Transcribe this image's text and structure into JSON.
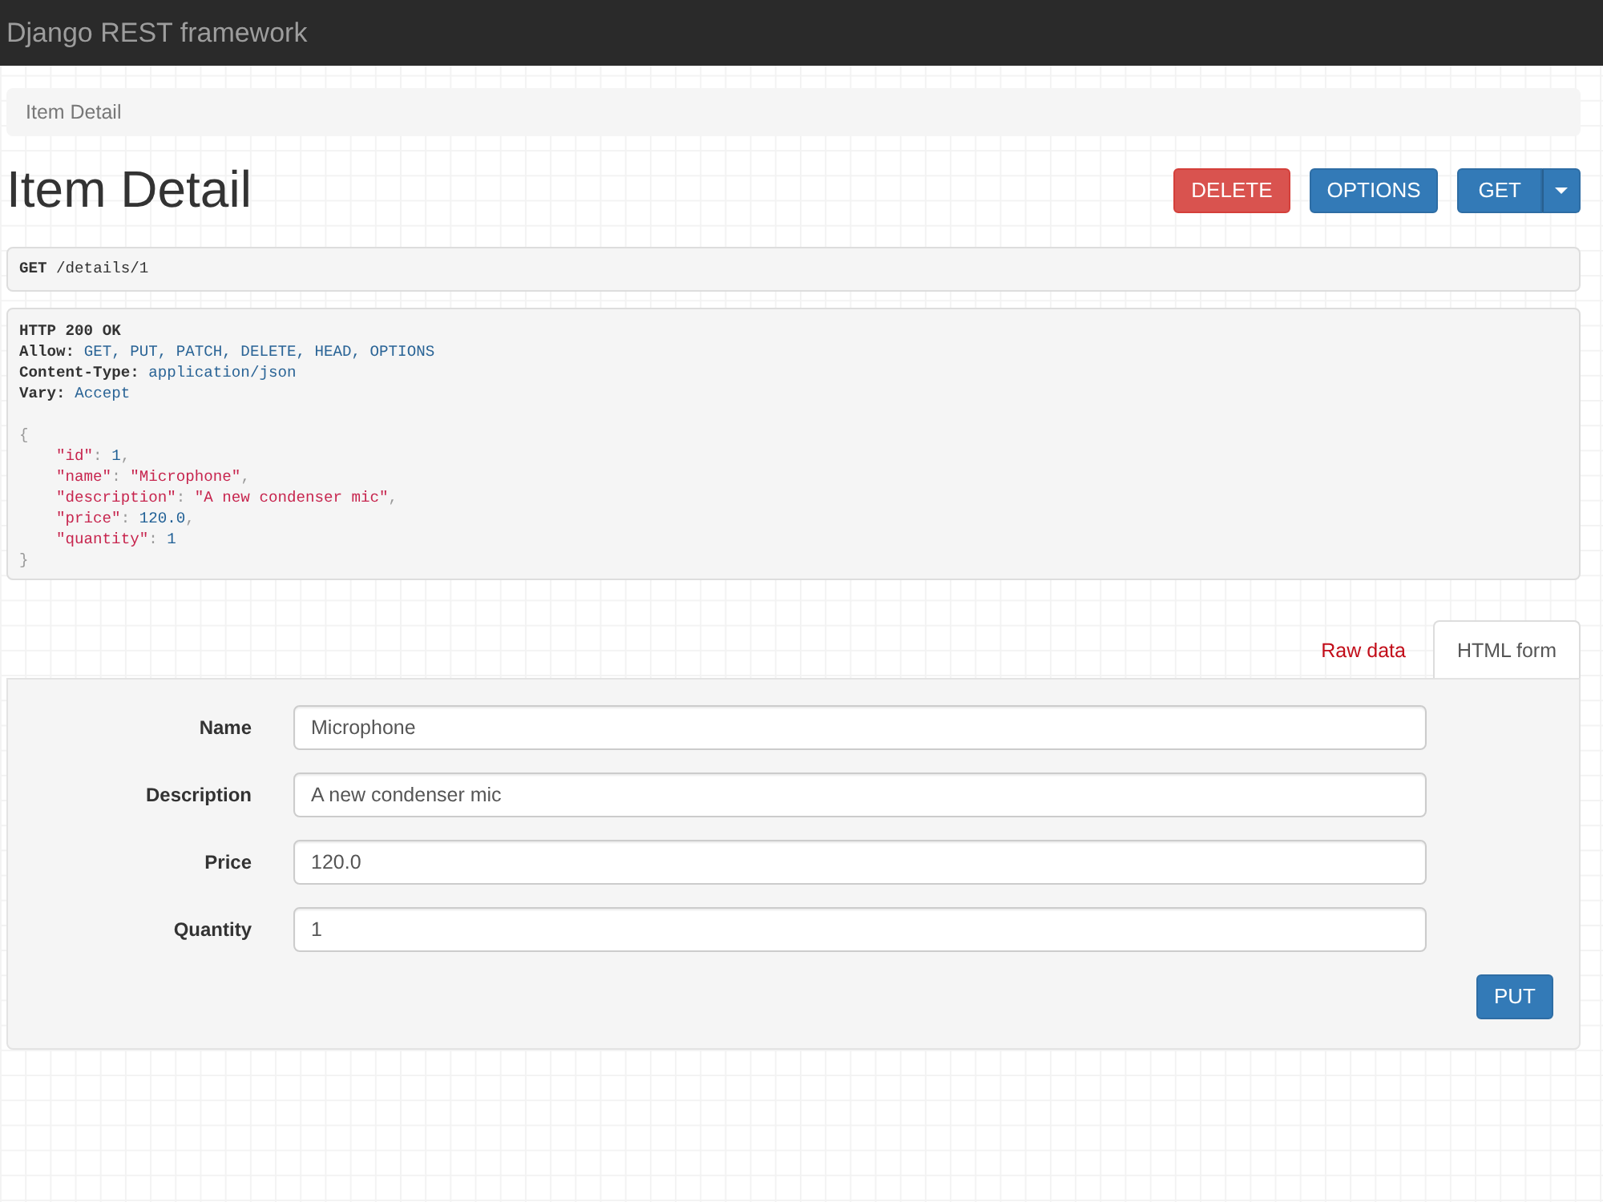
{
  "navbar": {
    "brand": "Django REST framework"
  },
  "breadcrumb": [
    "Item Detail"
  ],
  "header": {
    "title": "Item Detail",
    "actions": [
      {
        "label": "DELETE",
        "kind": "danger"
      },
      {
        "label": "OPTIONS",
        "kind": "primary"
      },
      {
        "label": "GET",
        "kind": "split"
      }
    ]
  },
  "request": {
    "method": "GET",
    "path": "/details/1"
  },
  "response": {
    "status": "HTTP 200 OK",
    "headers": [
      {
        "name": "Allow:",
        "value": "GET, PUT, PATCH, DELETE, HEAD, OPTIONS"
      },
      {
        "name": "Content-Type:",
        "value": "application/json"
      },
      {
        "name": "Vary:",
        "value": "Accept"
      }
    ],
    "body": {
      "open": "{",
      "members": [
        [
          {
            "text": "\"id\"",
            "kind": "key"
          },
          {
            "text": ":",
            "kind": "punct"
          },
          {
            "text": "1",
            "kind": "number"
          },
          {
            "text": ",",
            "kind": "punct"
          }
        ],
        [
          {
            "text": "\"name\"",
            "kind": "key"
          },
          {
            "text": ":",
            "kind": "punct"
          },
          {
            "text": "\"Microphone\"",
            "kind": "string"
          },
          {
            "text": ",",
            "kind": "punct"
          }
        ],
        [
          {
            "text": "\"description\"",
            "kind": "key"
          },
          {
            "text": ":",
            "kind": "punct"
          },
          {
            "text": "\"A new condenser mic\"",
            "kind": "string"
          },
          {
            "text": ",",
            "kind": "punct"
          }
        ],
        [
          {
            "text": "\"price\"",
            "kind": "key"
          },
          {
            "text": ":",
            "kind": "punct"
          },
          {
            "text": "120.0",
            "kind": "number"
          },
          {
            "text": ",",
            "kind": "punct"
          }
        ],
        [
          {
            "text": "\"quantity\"",
            "kind": "key"
          },
          {
            "text": ":",
            "kind": "punct"
          },
          {
            "text": "1",
            "kind": "number"
          }
        ]
      ],
      "close": "}"
    }
  },
  "tabs": [
    {
      "label": "Raw data",
      "selected": false
    },
    {
      "label": "HTML form",
      "selected": true
    }
  ],
  "form": {
    "fields": [
      {
        "label": "Name",
        "value": "Microphone"
      },
      {
        "label": "Description",
        "value": "A new condenser mic"
      },
      {
        "label": "Price",
        "value": "120.0"
      },
      {
        "label": "Quantity",
        "value": "1"
      }
    ],
    "submit": "PUT"
  }
}
